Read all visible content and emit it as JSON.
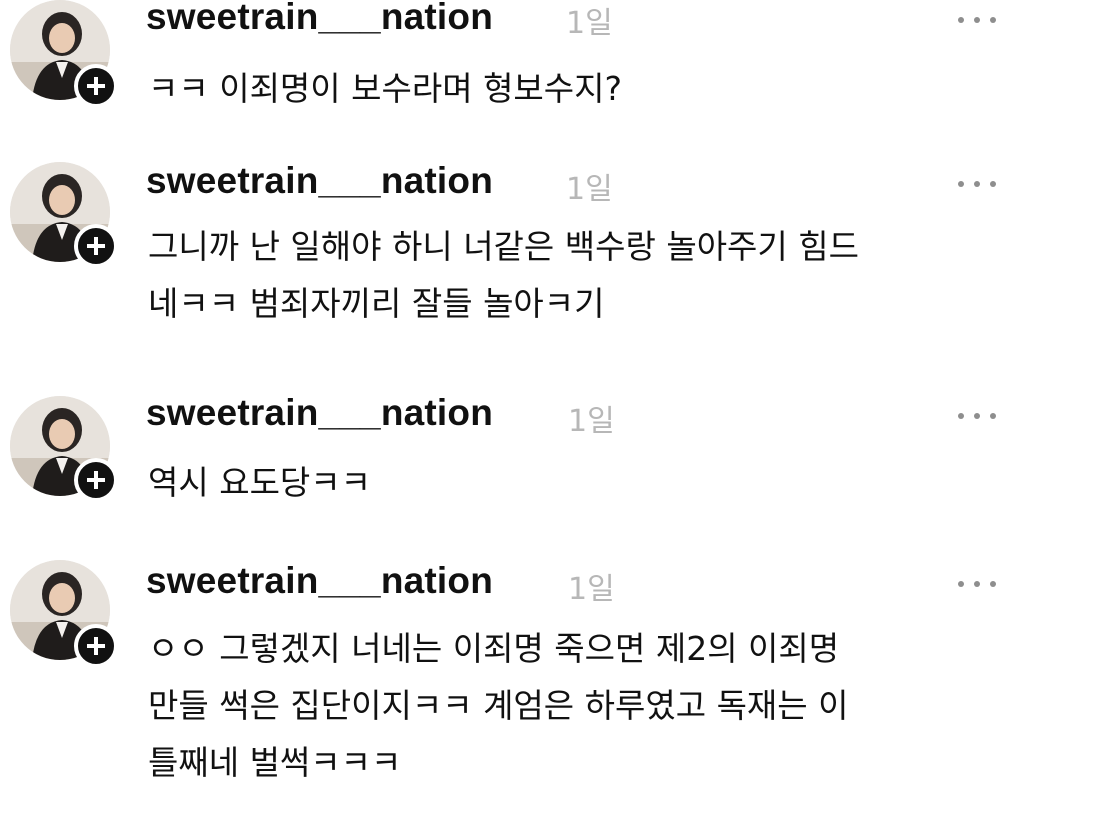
{
  "comments": [
    {
      "username": "sweetrain___nation",
      "time": "1일",
      "lines": [
        "ㅋㅋ 이죄명이 보수라며 형보수지?"
      ]
    },
    {
      "username": "sweetrain___nation",
      "time": "1일",
      "lines": [
        "그니까 난 일해야 하니 너같은 백수랑 놀아주기 힘드",
        "네ㅋㅋ 범죄자끼리 잘들 놀아ㅋ기"
      ]
    },
    {
      "username": "sweetrain___nation",
      "time": "1일",
      "lines": [
        "역시 요도당ㅋㅋ"
      ]
    },
    {
      "username": "sweetrain___nation",
      "time": "1일",
      "lines": [
        "ㅇㅇ 그렇겠지 너네는 이죄명 죽으면 제2의 이죄명",
        "만들 썩은 집단이지ㅋㅋ 계엄은 하루였고 독재는 이",
        "틀째네 벌썩ㅋㅋㅋ"
      ]
    }
  ],
  "colors": {
    "text": "#111111",
    "timestamp": "#b7b7b7",
    "more_icon": "#8e8e8e"
  },
  "icons": {
    "follow": "plus-icon",
    "more": "more-icon",
    "avatar": "profile-photo"
  }
}
